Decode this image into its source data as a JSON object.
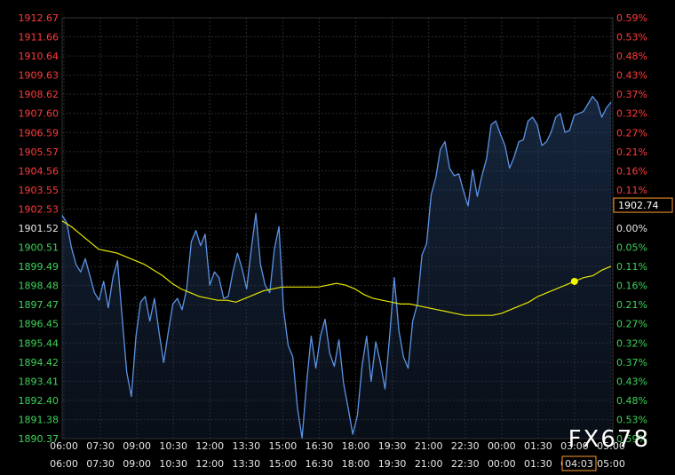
{
  "watermark": "FX678",
  "current_time_label": "04:03",
  "chart_data": {
    "type": "line",
    "title": "",
    "xlabel": "",
    "ylabel": "",
    "ylim": [
      1890.37,
      1912.67
    ],
    "base_price": 1901.52,
    "current_price": 1902.74,
    "grid": true,
    "left_ticks": [
      {
        "label": "1912.67",
        "color": "#ff3b3b"
      },
      {
        "label": "1911.66",
        "color": "#ff3b3b"
      },
      {
        "label": "1910.64",
        "color": "#ff3b3b"
      },
      {
        "label": "1909.63",
        "color": "#ff3b3b"
      },
      {
        "label": "1908.62",
        "color": "#ff3b3b"
      },
      {
        "label": "1907.60",
        "color": "#ff3b3b"
      },
      {
        "label": "1906.59",
        "color": "#ff3b3b"
      },
      {
        "label": "1905.57",
        "color": "#ff3b3b"
      },
      {
        "label": "1904.56",
        "color": "#ff3b3b"
      },
      {
        "label": "1903.55",
        "color": "#ff3b3b"
      },
      {
        "label": "1902.53",
        "color": "#ff3b3b"
      },
      {
        "label": "1901.52",
        "color": "#e6e6e6"
      },
      {
        "label": "1900.51",
        "color": "#3fd35a"
      },
      {
        "label": "1899.49",
        "color": "#3fd35a"
      },
      {
        "label": "1898.48",
        "color": "#3fd35a"
      },
      {
        "label": "1897.47",
        "color": "#3fd35a"
      },
      {
        "label": "1896.45",
        "color": "#3fd35a"
      },
      {
        "label": "1895.44",
        "color": "#3fd35a"
      },
      {
        "label": "1894.42",
        "color": "#3fd35a"
      },
      {
        "label": "1893.41",
        "color": "#3fd35a"
      },
      {
        "label": "1892.40",
        "color": "#3fd35a"
      },
      {
        "label": "1891.38",
        "color": "#3fd35a"
      },
      {
        "label": "1890.37",
        "color": "#3fd35a"
      }
    ],
    "right_ticks": [
      {
        "label": "0.59%",
        "color": "#ff3b3b"
      },
      {
        "label": "0.53%",
        "color": "#ff3b3b"
      },
      {
        "label": "0.48%",
        "color": "#ff3b3b"
      },
      {
        "label": "0.43%",
        "color": "#ff3b3b"
      },
      {
        "label": "0.37%",
        "color": "#ff3b3b"
      },
      {
        "label": "0.32%",
        "color": "#ff3b3b"
      },
      {
        "label": "0.27%",
        "color": "#ff3b3b"
      },
      {
        "label": "0.21%",
        "color": "#ff3b3b"
      },
      {
        "label": "0.16%",
        "color": "#ff3b3b"
      },
      {
        "label": "0.11%",
        "color": "#ff3b3b"
      },
      {
        "label": "0.05%",
        "color": "#ff3b3b"
      },
      {
        "label": "0.00%",
        "color": "#e6e6e6"
      },
      {
        "label": "0.05%",
        "color": "#3fd35a"
      },
      {
        "label": "0.11%",
        "color": "#3fd35a"
      },
      {
        "label": "0.16%",
        "color": "#3fd35a"
      },
      {
        "label": "0.21%",
        "color": "#3fd35a"
      },
      {
        "label": "0.27%",
        "color": "#3fd35a"
      },
      {
        "label": "0.32%",
        "color": "#3fd35a"
      },
      {
        "label": "0.37%",
        "color": "#3fd35a"
      },
      {
        "label": "0.43%",
        "color": "#3fd35a"
      },
      {
        "label": "0.48%",
        "color": "#3fd35a"
      },
      {
        "label": "0.53%",
        "color": "#3fd35a"
      },
      {
        "label": "0.59%",
        "color": "#3fd35a"
      }
    ],
    "x_ticks": [
      "06:00",
      "07:30",
      "09:00",
      "10:30",
      "12:00",
      "13:30",
      "15:00",
      "16:30",
      "18:00",
      "19:30",
      "21:00",
      "22:30",
      "00:00",
      "01:30",
      "03:00",
      "05:00"
    ],
    "series": [
      {
        "color": "#5b93e6",
        "values": [
          1902.2,
          1901.8,
          1900.5,
          1899.6,
          1899.2,
          1899.9,
          1899.0,
          1898.1,
          1897.7,
          1898.7,
          1897.3,
          1898.9,
          1899.8,
          1896.8,
          1893.9,
          1892.6,
          1895.8,
          1897.6,
          1897.9,
          1896.6,
          1897.8,
          1896.0,
          1894.4,
          1896.0,
          1897.5,
          1897.8,
          1897.2,
          1898.3,
          1900.8,
          1901.4,
          1900.6,
          1901.2,
          1898.5,
          1899.2,
          1898.9,
          1897.8,
          1897.9,
          1899.2,
          1900.2,
          1899.4,
          1898.3,
          1900.4,
          1902.3,
          1899.6,
          1898.5,
          1898.1,
          1900.4,
          1901.6,
          1897.2,
          1895.3,
          1894.7,
          1892.0,
          1890.4,
          1893.3,
          1895.8,
          1894.1,
          1895.8,
          1896.7,
          1894.9,
          1894.2,
          1895.6,
          1893.3,
          1892.0,
          1890.6,
          1891.6,
          1894.2,
          1895.8,
          1893.4,
          1895.5,
          1894.4,
          1893.0,
          1895.8,
          1898.9,
          1896.1,
          1894.7,
          1894.1,
          1896.6,
          1897.5,
          1900.1,
          1900.7,
          1903.3,
          1904.2,
          1905.7,
          1906.1,
          1904.7,
          1904.3,
          1904.4,
          1903.5,
          1902.7,
          1904.6,
          1903.2,
          1904.3,
          1905.2,
          1907.0,
          1907.2,
          1906.5,
          1905.9,
          1904.7,
          1905.3,
          1906.1,
          1906.2,
          1907.2,
          1907.4,
          1907.0,
          1905.9,
          1906.1,
          1906.6,
          1907.4,
          1907.6,
          1906.6,
          1906.7,
          1907.5,
          1907.6,
          1907.7,
          1908.1,
          1908.5,
          1908.2,
          1907.4,
          1907.9,
          1908.2
        ]
      },
      {
        "color": "#e6e600",
        "values": [
          1901.9,
          1901.6,
          1901.2,
          1900.8,
          1900.4,
          1900.3,
          1900.2,
          1900.0,
          1899.8,
          1899.6,
          1899.3,
          1899.0,
          1898.6,
          1898.3,
          1898.1,
          1897.9,
          1897.8,
          1897.7,
          1897.7,
          1897.6,
          1897.8,
          1898.0,
          1898.2,
          1898.3,
          1898.4,
          1898.4,
          1898.4,
          1898.4,
          1898.4,
          1898.5,
          1898.6,
          1898.5,
          1898.3,
          1898.0,
          1897.8,
          1897.7,
          1897.6,
          1897.5,
          1897.5,
          1897.4,
          1897.3,
          1897.2,
          1897.1,
          1897.0,
          1896.9,
          1896.9,
          1896.9,
          1896.9,
          1897.0,
          1897.2,
          1897.4,
          1897.6,
          1897.9,
          1898.1,
          1898.3,
          1898.5,
          1898.7,
          1898.9,
          1899.0,
          1899.3,
          1899.5
        ]
      }
    ]
  }
}
